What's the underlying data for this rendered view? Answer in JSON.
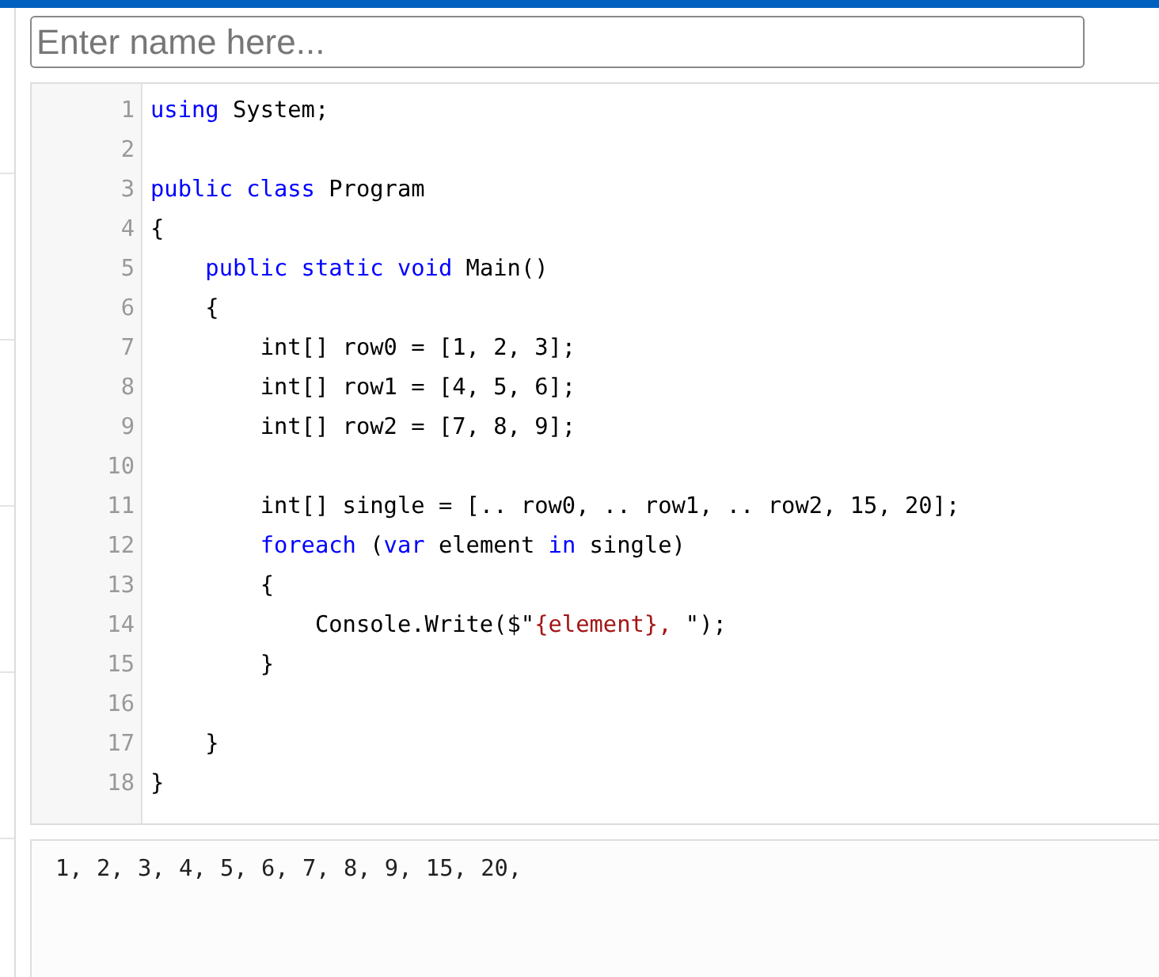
{
  "name_field": {
    "placeholder": "Enter name here..."
  },
  "code_lines": [
    {
      "number": "1",
      "tokens": [
        {
          "kind": "keyword",
          "text": "using"
        },
        {
          "kind": "plain",
          "text": " System;"
        }
      ]
    },
    {
      "number": "2"
    },
    {
      "number": "3",
      "tokens": [
        {
          "kind": "keyword",
          "text": "public"
        },
        {
          "kind": "keyword",
          "text": " class"
        },
        {
          "kind": "plain",
          "text": " Program"
        }
      ]
    },
    {
      "number": "4",
      "tokens": [
        {
          "kind": "plain",
          "text": "{"
        }
      ]
    },
    {
      "number": "5",
      "tokens": [
        {
          "kind": "keyword",
          "text": "    public"
        },
        {
          "kind": "keyword",
          "text": " static"
        },
        {
          "kind": "keyword",
          "text": " void"
        },
        {
          "kind": "plain",
          "text": " Main()"
        }
      ]
    },
    {
      "number": "6",
      "tokens": [
        {
          "kind": "plain",
          "text": "    {"
        }
      ]
    },
    {
      "number": "7",
      "tokens": [
        {
          "kind": "plain",
          "text": "        int[] row0 = [1, 2, 3];"
        }
      ]
    },
    {
      "number": "8",
      "tokens": [
        {
          "kind": "plain",
          "text": "        int[] row1 = [4, 5, 6];"
        }
      ]
    },
    {
      "number": "9",
      "tokens": [
        {
          "kind": "plain",
          "text": "        int[] row2 = [7, 8, 9];"
        }
      ]
    },
    {
      "number": "10"
    },
    {
      "number": "11",
      "tokens": [
        {
          "kind": "plain",
          "text": "        int[] single = [.. row0, .. row1, .. row2, 15, 20];"
        }
      ]
    },
    {
      "number": "12",
      "tokens": [
        {
          "kind": "keyword",
          "text": "        foreach"
        },
        {
          "kind": "plain",
          "text": " ("
        },
        {
          "kind": "keyword",
          "text": "var"
        },
        {
          "kind": "plain",
          "text": " element "
        },
        {
          "kind": "keyword",
          "text": "in"
        },
        {
          "kind": "plain",
          "text": " single)"
        }
      ]
    },
    {
      "number": "13",
      "tokens": [
        {
          "kind": "plain",
          "text": "        {"
        }
      ]
    },
    {
      "number": "14",
      "tokens": [
        {
          "kind": "plain",
          "text": "            Console.Write($\""
        },
        {
          "kind": "string",
          "text": "{element}, "
        },
        {
          "kind": "plain",
          "text": "\");"
        }
      ]
    },
    {
      "number": "15",
      "tokens": [
        {
          "kind": "plain",
          "text": "        }"
        }
      ]
    },
    {
      "number": "16"
    },
    {
      "number": "17",
      "tokens": [
        {
          "kind": "plain",
          "text": "    }"
        }
      ]
    },
    {
      "number": "18",
      "tokens": [
        {
          "kind": "plain",
          "text": "}"
        }
      ]
    }
  ],
  "output": {
    "text": "1, 2, 3, 4, 5, 6, 7, 8, 9, 15, 20,"
  }
}
